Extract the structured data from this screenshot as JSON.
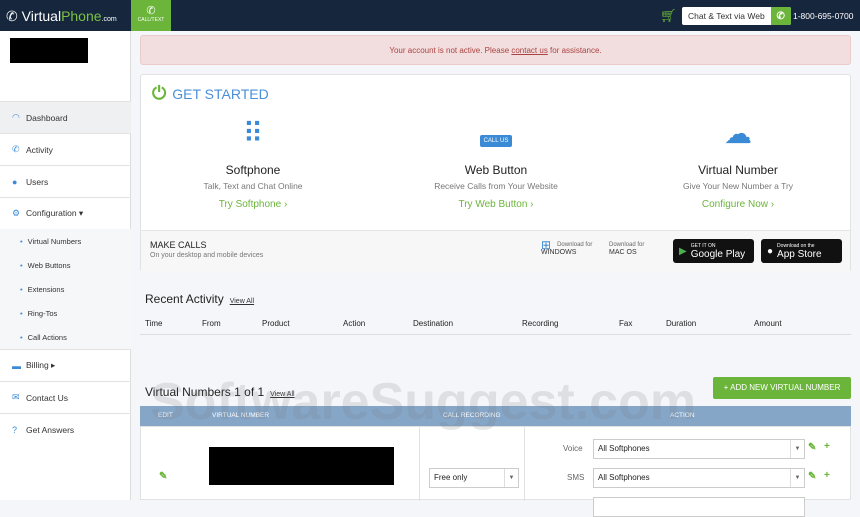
{
  "header": {
    "logo_main": "Virtual",
    "logo_accent": "Phone",
    "logo_suffix": ".com",
    "call_text": "CALL/TEXT",
    "chat_button": "Chat & Text via Web",
    "phone": "1-800-695-0700"
  },
  "sidebar": {
    "items": [
      {
        "label": "Dashboard",
        "icon": "gauge-icon"
      },
      {
        "label": "Activity",
        "icon": "phone-icon"
      },
      {
        "label": "Users",
        "icon": "user-icon"
      },
      {
        "label": "Configuration ▾",
        "icon": "gear-icon"
      }
    ],
    "sub_items": [
      "Virtual Numbers",
      "Web Buttons",
      "Extensions",
      "Ring-Tos",
      "Call Actions"
    ],
    "items2": [
      {
        "label": "Billing ▸"
      },
      {
        "label": "Contact Us"
      },
      {
        "label": "Get Answers"
      }
    ]
  },
  "alert": {
    "before": "Your account is not active. Please ",
    "link": "contact us",
    "after": " for assistance."
  },
  "get_started": {
    "title": "GET STARTED",
    "features": [
      {
        "title": "Softphone",
        "desc": "Talk, Text and Chat Online",
        "link": "Try Softphone ›"
      },
      {
        "title": "Web Button",
        "desc": "Receive Calls from Your Website",
        "link": "Try Web Button ›",
        "badge": "CALL US"
      },
      {
        "title": "Virtual Number",
        "desc": "Give Your New Number a Try",
        "link": "Configure Now ›"
      }
    ]
  },
  "make_calls": {
    "title": "MAKE CALLS",
    "subtitle": "On your desktop and mobile devices",
    "windows_small": "Download for",
    "windows": "WINDOWS",
    "mac_small": "Download for",
    "mac": "MAC OS",
    "gp_small": "GET IT ON",
    "gp": "Google Play",
    "as_small": "Download on the",
    "as": "App Store"
  },
  "recent": {
    "title": "Recent Activity",
    "view_all": "View All",
    "columns": [
      "Time",
      "From",
      "Product",
      "Action",
      "Destination",
      "Recording",
      "Fax",
      "Duration",
      "Amount"
    ]
  },
  "virtual_numbers": {
    "title": "Virtual Numbers 1 of 1",
    "view_all": "View All",
    "add_button": "+ ADD NEW VIRTUAL NUMBER",
    "columns": [
      "EDIT",
      "VIRTUAL NUMBER",
      "CALL RECORDING",
      "ACTION"
    ],
    "row": {
      "recording": "Free only",
      "voice_label": "Voice",
      "voice": "All Softphones",
      "sms_label": "SMS",
      "sms": "All Softphones"
    }
  },
  "watermark": "SoftwareSuggest.com"
}
